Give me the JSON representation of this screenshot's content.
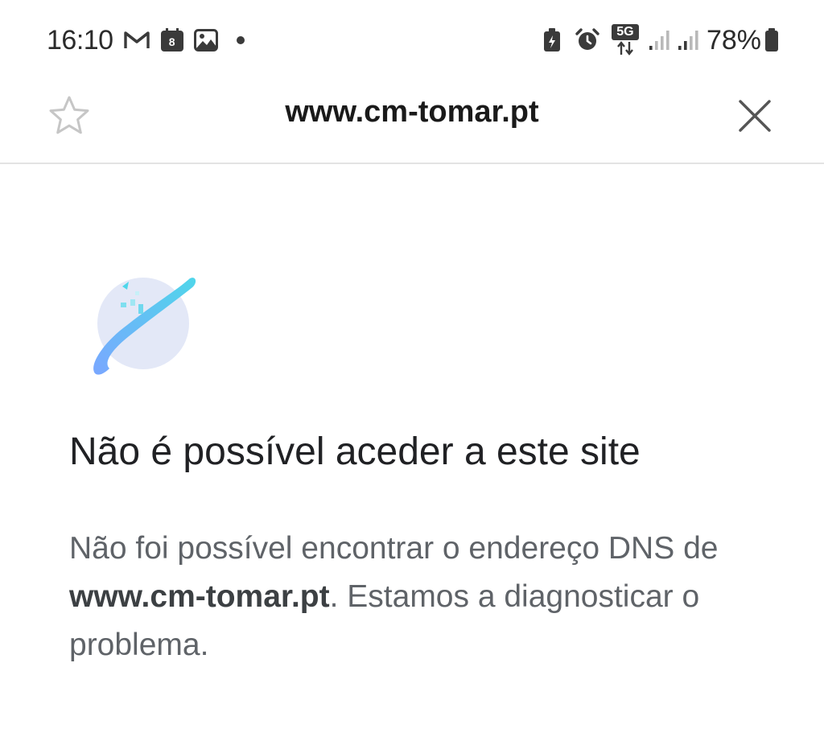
{
  "status_bar": {
    "time": "16:10",
    "calendar_day": "8",
    "network_type": "5G",
    "battery_percent": "78%",
    "left_icons": [
      "gmail-icon",
      "calendar-icon",
      "gallery-icon",
      "notification-dot-icon"
    ],
    "right_icons": [
      "battery-saver-icon",
      "alarm-icon",
      "network-5g-icon",
      "signal-icon",
      "signal-icon",
      "battery-icon"
    ]
  },
  "toolbar": {
    "url": "www.cm-tomar.pt"
  },
  "error": {
    "title": "Não é possível aceder a este site",
    "desc_before": "Não foi possível encontrar o endereço DNS de ",
    "desc_host": "www.cm-tomar.pt",
    "desc_after": ". Estamos a diagnosticar o problema."
  },
  "colors": {
    "accent_gradient_start": "#7aa7ff",
    "accent_gradient_end": "#4fd6ea",
    "planet": "#e3e8f7"
  }
}
